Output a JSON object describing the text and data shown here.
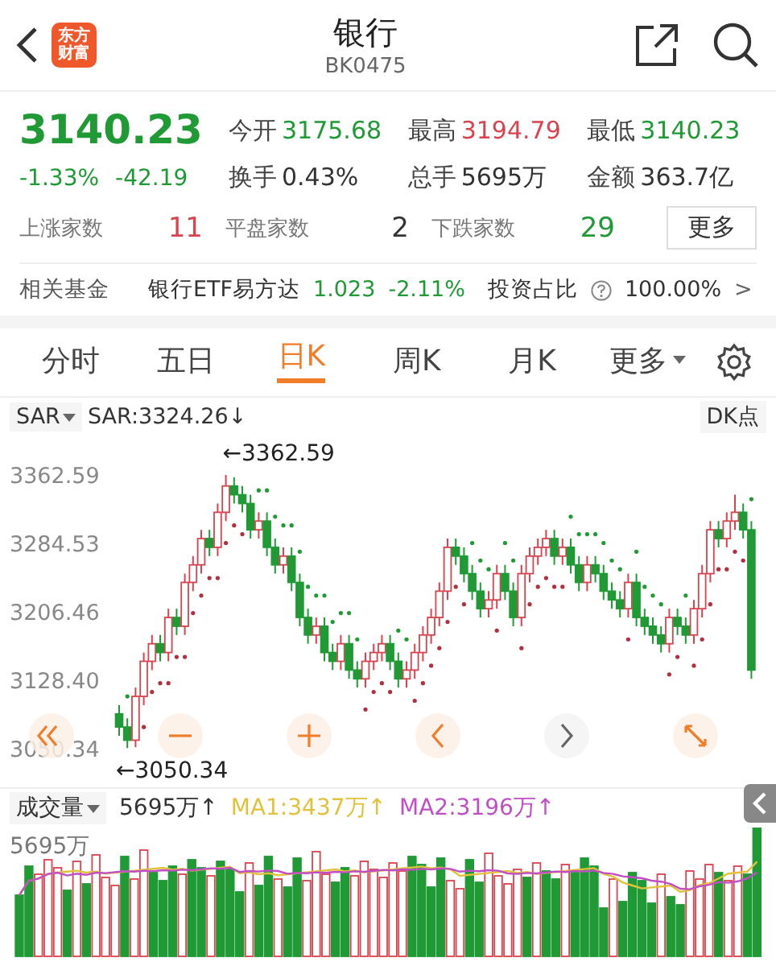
{
  "header": {
    "logo": [
      "东方",
      "财富"
    ],
    "title": "银行",
    "code": "BK0475"
  },
  "quote": {
    "price": "3140.23",
    "change_pct": "-1.33%",
    "change": "-42.19",
    "color": "#1f9a35",
    "stats": [
      {
        "label": "今开",
        "value": "3175.68",
        "color": "#1f9a35"
      },
      {
        "label": "最高",
        "value": "3194.79",
        "color": "#d9434e"
      },
      {
        "label": "最低",
        "value": "3140.23",
        "color": "#1f9a35"
      },
      {
        "label": "换手",
        "value": "0.43%",
        "color": "#333333"
      },
      {
        "label": "总手",
        "value": "5695万",
        "color": "#333333"
      },
      {
        "label": "金额",
        "value": "363.7亿",
        "color": "#333333"
      }
    ],
    "breadth": [
      {
        "label": "上涨家数",
        "value": "11",
        "color": "#d9434e"
      },
      {
        "label": "平盘家数",
        "value": "2",
        "color": "#333333"
      },
      {
        "label": "下跌家数",
        "value": "29",
        "color": "#1f9a35"
      }
    ],
    "more_button": "更多"
  },
  "fund": {
    "label": "相关基金",
    "name": "银行ETF易方达",
    "price": "1.023",
    "change": "-2.11%",
    "color": "#1f9a35",
    "ratio_label": "投资占比",
    "ratio": "100.00%",
    "chevron": ">"
  },
  "tabs": [
    {
      "label": "分时",
      "selected": false,
      "kind": "plain"
    },
    {
      "label": "五日",
      "selected": false,
      "kind": "plain"
    },
    {
      "label": "日K",
      "selected": true,
      "kind": "plain"
    },
    {
      "label": "周K",
      "selected": false,
      "kind": "plain"
    },
    {
      "label": "月K",
      "selected": false,
      "kind": "plain"
    },
    {
      "label": "更多",
      "selected": false,
      "kind": "dropdown"
    }
  ],
  "chart": {
    "indicator": "SAR",
    "indicator_value": "SAR:3324.26↓",
    "dk_button": "DK点",
    "max_marker": "←3362.59",
    "min_marker": "←3050.34",
    "chart_data": {
      "type": "candlestick",
      "ylim": [
        3050.34,
        3362.59
      ],
      "yticks": [
        {
          "value": 3362.59,
          "label": "3362.59"
        },
        {
          "value": 3284.53,
          "label": "3284.53"
        },
        {
          "value": 3206.46,
          "label": "3206.46"
        },
        {
          "value": 3128.4,
          "label": "3128.40"
        },
        {
          "value": 3050.34,
          "label": "3050.34"
        }
      ],
      "ohlc": [
        [
          3090,
          3100,
          3065,
          3075
        ],
        [
          3075,
          3085,
          3051,
          3060
        ],
        [
          3060,
          3120,
          3052,
          3110
        ],
        [
          3110,
          3160,
          3100,
          3150
        ],
        [
          3150,
          3180,
          3140,
          3170
        ],
        [
          3170,
          3180,
          3150,
          3160
        ],
        [
          3160,
          3210,
          3150,
          3200
        ],
        [
          3200,
          3210,
          3180,
          3190
        ],
        [
          3190,
          3250,
          3180,
          3240
        ],
        [
          3240,
          3270,
          3230,
          3260
        ],
        [
          3260,
          3300,
          3250,
          3290
        ],
        [
          3290,
          3300,
          3270,
          3280
        ],
        [
          3280,
          3330,
          3270,
          3320
        ],
        [
          3320,
          3362.59,
          3310,
          3350
        ],
        [
          3350,
          3360,
          3330,
          3340
        ],
        [
          3340,
          3350,
          3320,
          3330
        ],
        [
          3330,
          3340,
          3290,
          3300
        ],
        [
          3300,
          3320,
          3290,
          3310
        ],
        [
          3310,
          3320,
          3270,
          3280
        ],
        [
          3280,
          3290,
          3250,
          3260
        ],
        [
          3260,
          3280,
          3250,
          3270
        ],
        [
          3270,
          3280,
          3230,
          3240
        ],
        [
          3240,
          3250,
          3190,
          3200
        ],
        [
          3200,
          3210,
          3170,
          3180
        ],
        [
          3180,
          3200,
          3170,
          3190
        ],
        [
          3190,
          3200,
          3150,
          3160
        ],
        [
          3160,
          3170,
          3140,
          3150
        ],
        [
          3150,
          3180,
          3140,
          3170
        ],
        [
          3170,
          3180,
          3130,
          3140
        ],
        [
          3140,
          3150,
          3120,
          3130
        ],
        [
          3130,
          3160,
          3120,
          3150
        ],
        [
          3150,
          3170,
          3140,
          3160
        ],
        [
          3160,
          3180,
          3150,
          3170
        ],
        [
          3170,
          3180,
          3140,
          3150
        ],
        [
          3150,
          3160,
          3120,
          3130
        ],
        [
          3130,
          3150,
          3120,
          3140
        ],
        [
          3140,
          3170,
          3130,
          3160
        ],
        [
          3160,
          3190,
          3150,
          3180
        ],
        [
          3180,
          3210,
          3170,
          3200
        ],
        [
          3200,
          3240,
          3190,
          3230
        ],
        [
          3230,
          3290,
          3220,
          3280
        ],
        [
          3280,
          3290,
          3260,
          3270
        ],
        [
          3270,
          3280,
          3240,
          3250
        ],
        [
          3250,
          3260,
          3220,
          3230
        ],
        [
          3230,
          3240,
          3200,
          3210
        ],
        [
          3210,
          3230,
          3200,
          3220
        ],
        [
          3220,
          3260,
          3210,
          3250
        ],
        [
          3250,
          3260,
          3220,
          3230
        ],
        [
          3230,
          3240,
          3190,
          3200
        ],
        [
          3200,
          3260,
          3190,
          3250
        ],
        [
          3250,
          3280,
          3240,
          3270
        ],
        [
          3270,
          3290,
          3260,
          3280
        ],
        [
          3280,
          3300,
          3270,
          3290
        ],
        [
          3290,
          3300,
          3260,
          3270
        ],
        [
          3270,
          3290,
          3260,
          3280
        ],
        [
          3280,
          3290,
          3250,
          3260
        ],
        [
          3260,
          3270,
          3230,
          3240
        ],
        [
          3240,
          3270,
          3230,
          3260
        ],
        [
          3260,
          3270,
          3240,
          3250
        ],
        [
          3250,
          3260,
          3220,
          3230
        ],
        [
          3230,
          3240,
          3210,
          3220
        ],
        [
          3220,
          3230,
          3200,
          3210
        ],
        [
          3210,
          3250,
          3200,
          3240
        ],
        [
          3240,
          3250,
          3190,
          3200
        ],
        [
          3200,
          3210,
          3180,
          3190
        ],
        [
          3190,
          3200,
          3170,
          3180
        ],
        [
          3180,
          3190,
          3160,
          3170
        ],
        [
          3170,
          3210,
          3160,
          3200
        ],
        [
          3200,
          3210,
          3180,
          3190
        ],
        [
          3190,
          3200,
          3170,
          3180
        ],
        [
          3180,
          3220,
          3170,
          3210
        ],
        [
          3210,
          3260,
          3200,
          3250
        ],
        [
          3250,
          3310,
          3240,
          3300
        ],
        [
          3300,
          3310,
          3280,
          3290
        ],
        [
          3290,
          3320,
          3280,
          3310
        ],
        [
          3310,
          3340,
          3300,
          3320
        ],
        [
          3320,
          3330,
          3290,
          3300
        ],
        [
          3300,
          3310,
          3130,
          3140
        ]
      ]
    }
  },
  "volume": {
    "indicator": "成交量",
    "value": "5695万↑",
    "ma1": "MA1:3437万↑",
    "ma2": "MA2:3196万↑",
    "max_label": "5695万"
  }
}
